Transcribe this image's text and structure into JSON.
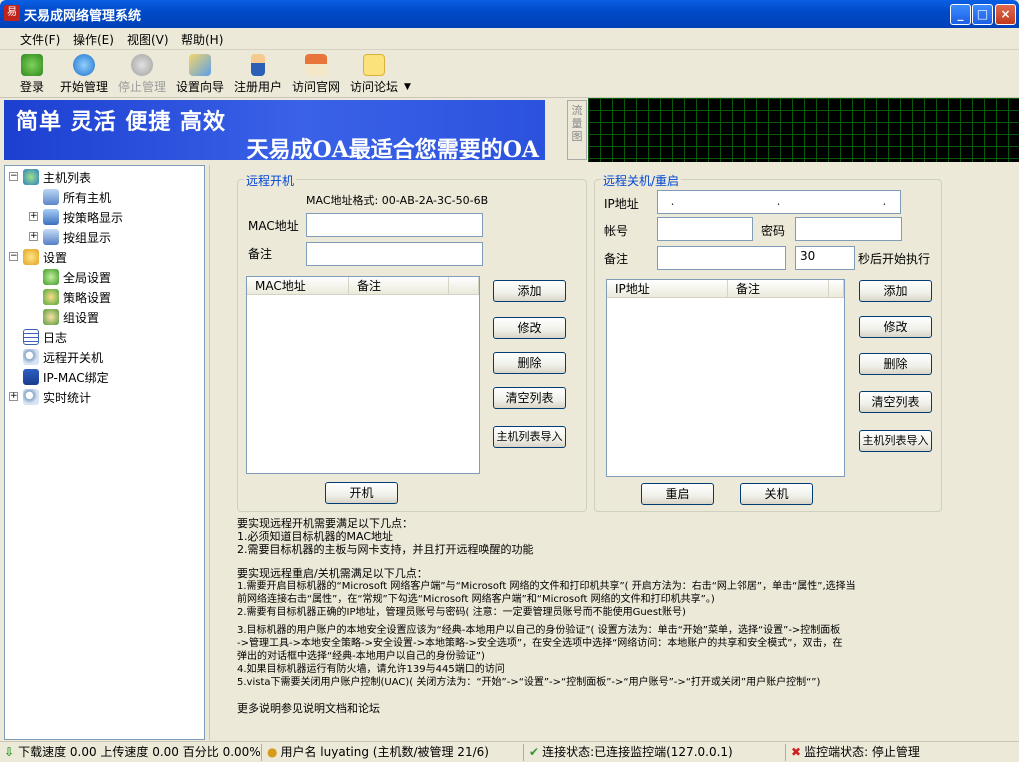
{
  "window": {
    "title": "天易成网络管理系统",
    "icon_text": "易"
  },
  "menu": [
    "文件(F)",
    "操作(E)",
    "视图(V)",
    "帮助(H)"
  ],
  "toolbar": [
    "登录",
    "开始管理",
    "停止管理",
    "设置向导",
    "注册用户",
    "访问官网",
    "访问论坛"
  ],
  "banner": {
    "line1": "简单 灵活 便捷 高效",
    "line2": "天易成OA最适合您需要的OA"
  },
  "flow_label": "流量图",
  "tree": [
    {
      "label": "主机列表"
    },
    {
      "label": "所有主机"
    },
    {
      "label": "按策略显示"
    },
    {
      "label": "按组显示"
    },
    {
      "label": "设置"
    },
    {
      "label": "全局设置"
    },
    {
      "label": "策略设置"
    },
    {
      "label": "组设置"
    },
    {
      "label": "日志"
    },
    {
      "label": "远程开关机"
    },
    {
      "label": "IP-MAC绑定"
    },
    {
      "label": "实时统计"
    }
  ],
  "wake": {
    "title": "远程开机",
    "mac_format": "MAC地址格式: 00-AB-2A-3C-50-6B",
    "mac_label": "MAC地址",
    "note_label": "备注",
    "col_mac": "MAC地址",
    "col_note": "备注",
    "btn_add": "添加",
    "btn_edit": "修改",
    "btn_delete": "删除",
    "btn_clear": "清空列表",
    "btn_import": "主机列表导入",
    "btn_boot": "开机"
  },
  "shutdown": {
    "title": "远程关机/重启",
    "ip_label": "IP地址",
    "account_label": "帐号",
    "password_label": "密码",
    "note_label": "备注",
    "delay_value": "30",
    "delay_suffix": "秒后开始执行",
    "col_ip": "IP地址",
    "col_note": "备注",
    "btn_add": "添加",
    "btn_edit": "修改",
    "btn_delete": "删除",
    "btn_clear": "清空列表",
    "btn_import": "主机列表导入",
    "btn_restart": "重启",
    "btn_shutdown": "关机"
  },
  "info": [
    "要实现远程开机需要满足以下几点：",
    "1.必须知道目标机器的MAC地址",
    "2.需要目标机器的主板与网卡支持，并且打开远程唤醒的功能",
    "要实现远程重启/关机需满足以下几点：",
    "1.需要开启目标机器的“Microsoft 网络客户端”与“Microsoft 网络的文件和打印机共享”( 开启方法为：右击“网上邻居”，单击“属性”,选择当",
    "前网络连接右击“属性”，在“常规”下勾选“Microsoft 网络客户端”和“Microsoft 网络的文件和打印机共享”。)",
    "2.需要有目标机器正确的IP地址，管理员账号与密码( 注意：一定要管理员账号而不能使用Guest账号)",
    "3.目标机器的用户账户的本地安全设置应该为“经典-本地用户以自己的身份验证”( 设置方法为：单击“开始”菜单，选择“设置”->控制面板",
    "->管理工具->本地安全策略->安全设置->本地策略->安全选项”，在安全选项中选择“网络访问：本地账户的共享和安全模式”，双击，在",
    "弹出的对话框中选择“经典-本地用户以自己的身份验证”)",
    "4.如果目标机器运行有防火墙，请允许139与445端口的访问",
    "5.vista下需要关闭用户账户控制(UAC)( 关闭方法为：“开始”->“设置”->“控制面板”->“用户账号”->“打开或关闭”用户账户控制“”)",
    "更多说明参见说明文档和论坛"
  ],
  "status": {
    "speed": "下载速度 0.00 上传速度 0.00 百分比 0.00%",
    "user": "用户名 luyating (主机数/被管理 21/6)",
    "connection": "连接状态:已连接监控端(127.0.0.1)",
    "monitor": "监控端状态: 停止管理"
  },
  "colors": {
    "title_bar": "#0054e3",
    "group_title": "#0046d5",
    "banner": "#2b52dd"
  }
}
